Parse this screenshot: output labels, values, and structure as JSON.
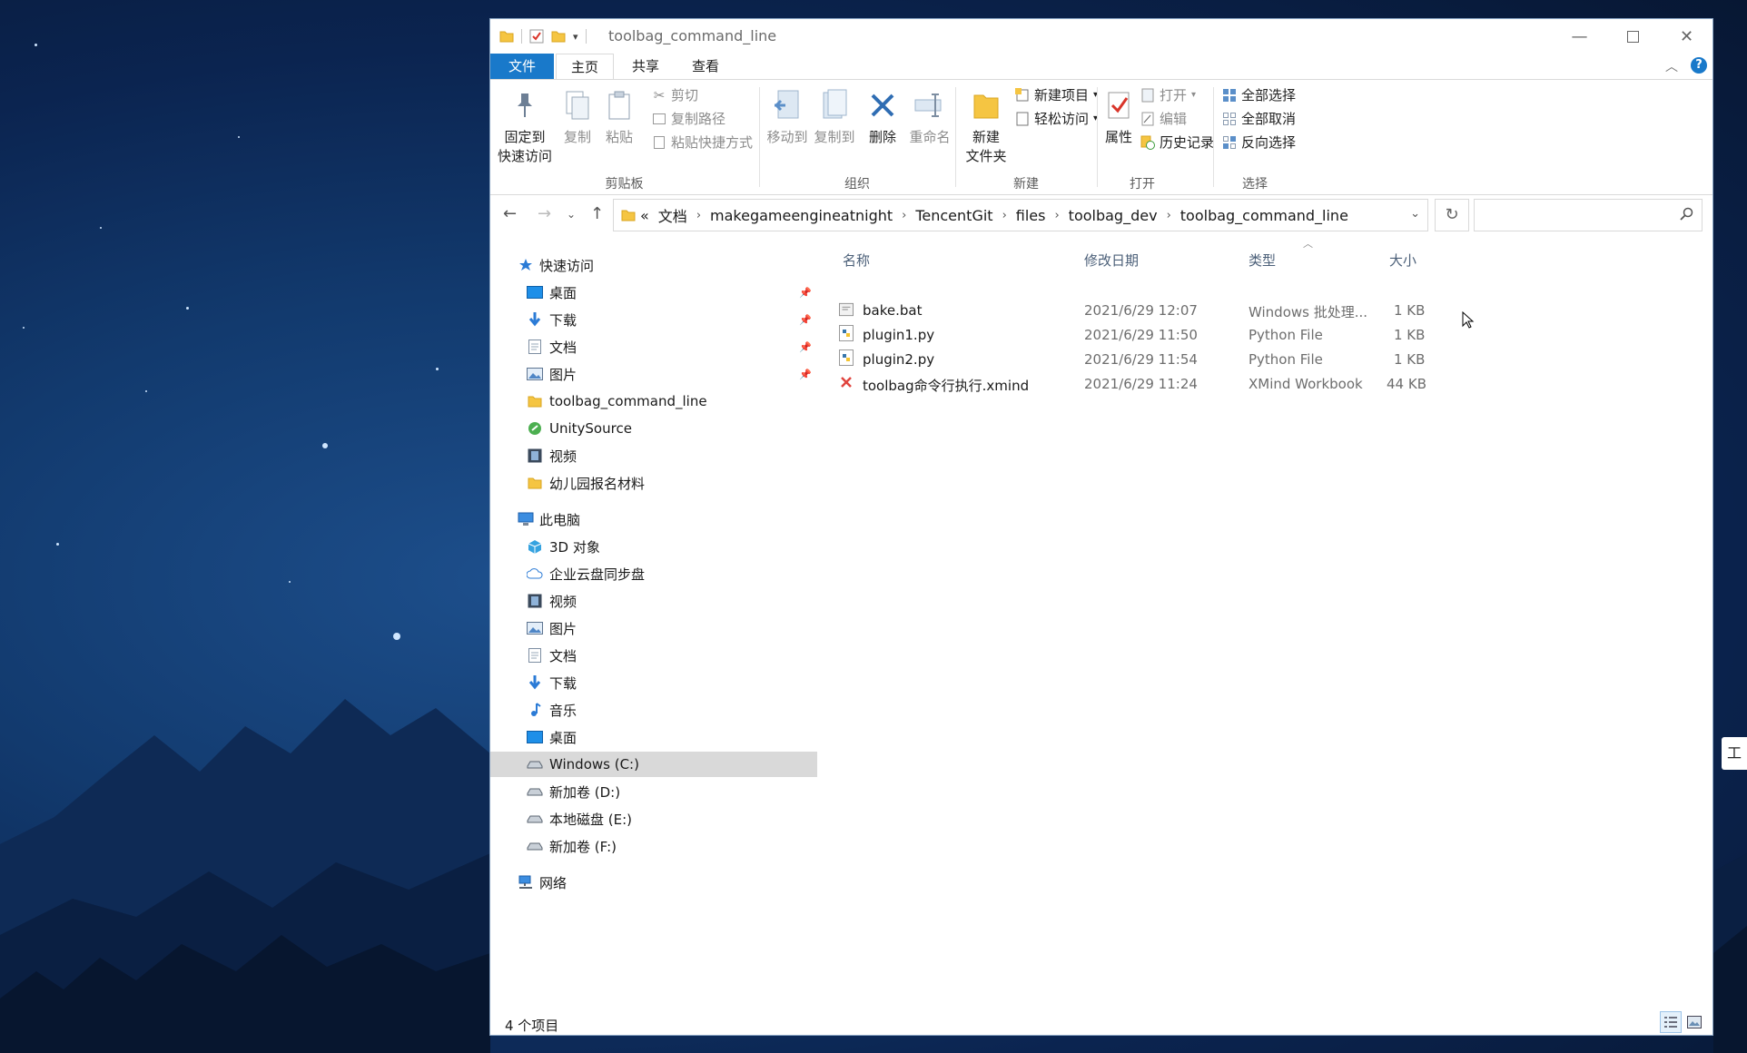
{
  "window": {
    "title": "toolbag_command_line",
    "controls": {
      "minimize_icon": "minimize-icon",
      "maximize_icon": "maximize-icon",
      "close_icon": "close-icon"
    }
  },
  "tabs": {
    "file": "文件",
    "home": "主页",
    "share": "共享",
    "view": "查看"
  },
  "ribbon": {
    "clipboard": {
      "group": "剪贴板",
      "pin_line1": "固定到",
      "pin_line2": "快速访问",
      "copy": "复制",
      "paste": "粘贴",
      "cut": "剪切",
      "copy_path": "复制路径",
      "paste_shortcut": "粘贴快捷方式"
    },
    "organize": {
      "group": "组织",
      "move_to": "移动到",
      "copy_to": "复制到",
      "delete": "删除",
      "rename": "重命名"
    },
    "new": {
      "group": "新建",
      "new_folder_line1": "新建",
      "new_folder_line2": "文件夹",
      "new_item": "新建项目",
      "easy_access": "轻松访问"
    },
    "open": {
      "group": "打开",
      "properties": "属性",
      "open": "打开",
      "edit": "编辑",
      "history": "历史记录"
    },
    "select": {
      "group": "选择",
      "select_all": "全部选择",
      "select_none": "全部取消",
      "invert": "反向选择"
    }
  },
  "address": {
    "prefix": "«",
    "breadcrumbs": [
      "文档",
      "makegameengineatnight",
      "TencentGit",
      "files",
      "toolbag_dev",
      "toolbag_command_line"
    ],
    "search_placeholder": ""
  },
  "nav_pane": {
    "quick_access": "快速访问",
    "quick_items": [
      "桌面",
      "下载",
      "文档",
      "图片",
      "toolbag_command_line",
      "UnitySource",
      "视频",
      "幼儿园报名材料"
    ],
    "this_pc": "此电脑",
    "pc_items": [
      "3D 对象",
      "企业云盘同步盘",
      "视频",
      "图片",
      "文档",
      "下载",
      "音乐",
      "桌面",
      "Windows (C:)",
      "新加卷 (D:)",
      "本地磁盘 (E:)",
      "新加卷 (F:)"
    ],
    "selected": "Windows (C:)",
    "network": "网络"
  },
  "columns": {
    "name": "名称",
    "date": "修改日期",
    "type": "类型",
    "size": "大小"
  },
  "files": [
    {
      "name": "bake.bat",
      "date": "2021/6/29 12:07",
      "type": "Windows 批处理...",
      "size": "1 KB",
      "icon": "batch-file-icon"
    },
    {
      "name": "plugin1.py",
      "date": "2021/6/29 11:50",
      "type": "Python File",
      "size": "1 KB",
      "icon": "python-file-icon"
    },
    {
      "name": "plugin2.py",
      "date": "2021/6/29 11:54",
      "type": "Python File",
      "size": "1 KB",
      "icon": "python-file-icon"
    },
    {
      "name": "toolbag命令行执行.xmind",
      "date": "2021/6/29 11:24",
      "type": "XMind Workbook",
      "size": "44 KB",
      "icon": "xmind-file-icon"
    }
  ],
  "status": {
    "item_count": "4 个项目"
  },
  "edge_tab": "工",
  "colors": {
    "accent": "#1979ca",
    "selection": "#d9d9d9",
    "folder": "#f5c542"
  }
}
